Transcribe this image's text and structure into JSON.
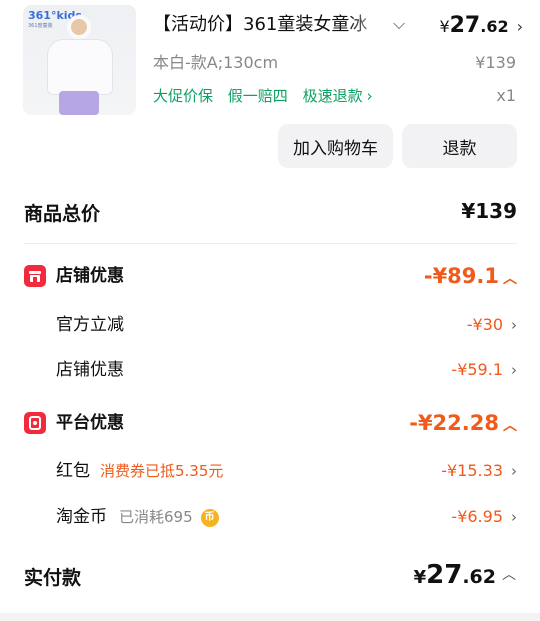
{
  "product": {
    "title": "【活动价】361童装女童冰",
    "price_yen": "¥",
    "price_int": "27",
    "price_dec": ".62",
    "variant": "本白-款A;130cm",
    "original_price": "¥139",
    "tags": [
      "大促价保",
      "假一赔四",
      "极速退款"
    ],
    "quantity": "x1",
    "thumb_brand": "361°kids",
    "thumb_brand_sub": "361度童装"
  },
  "buttons": {
    "add_cart": "加入购物车",
    "refund": "退款"
  },
  "summary": {
    "total_label": "商品总价",
    "total_value": "¥139"
  },
  "store_discount": {
    "label": "店铺优惠",
    "value": "-¥89.1",
    "items": [
      {
        "label": "官方立减",
        "value": "-¥30"
      },
      {
        "label": "店铺优惠",
        "value": "-¥59.1"
      }
    ]
  },
  "platform_discount": {
    "label": "平台优惠",
    "value": "-¥22.28",
    "items": [
      {
        "label": "红包",
        "note": "消费券已抵5.35元",
        "value": "-¥15.33"
      },
      {
        "label": "淘金币",
        "note": "已消耗695",
        "coin": "币",
        "value": "-¥6.95"
      }
    ]
  },
  "paid": {
    "label": "实付款",
    "yen": "¥",
    "int": "27",
    "dec": ".62"
  },
  "colors": {
    "discount": "#f05a1a",
    "tag_green": "#0fa066",
    "icon_red": "#f22b3c"
  }
}
